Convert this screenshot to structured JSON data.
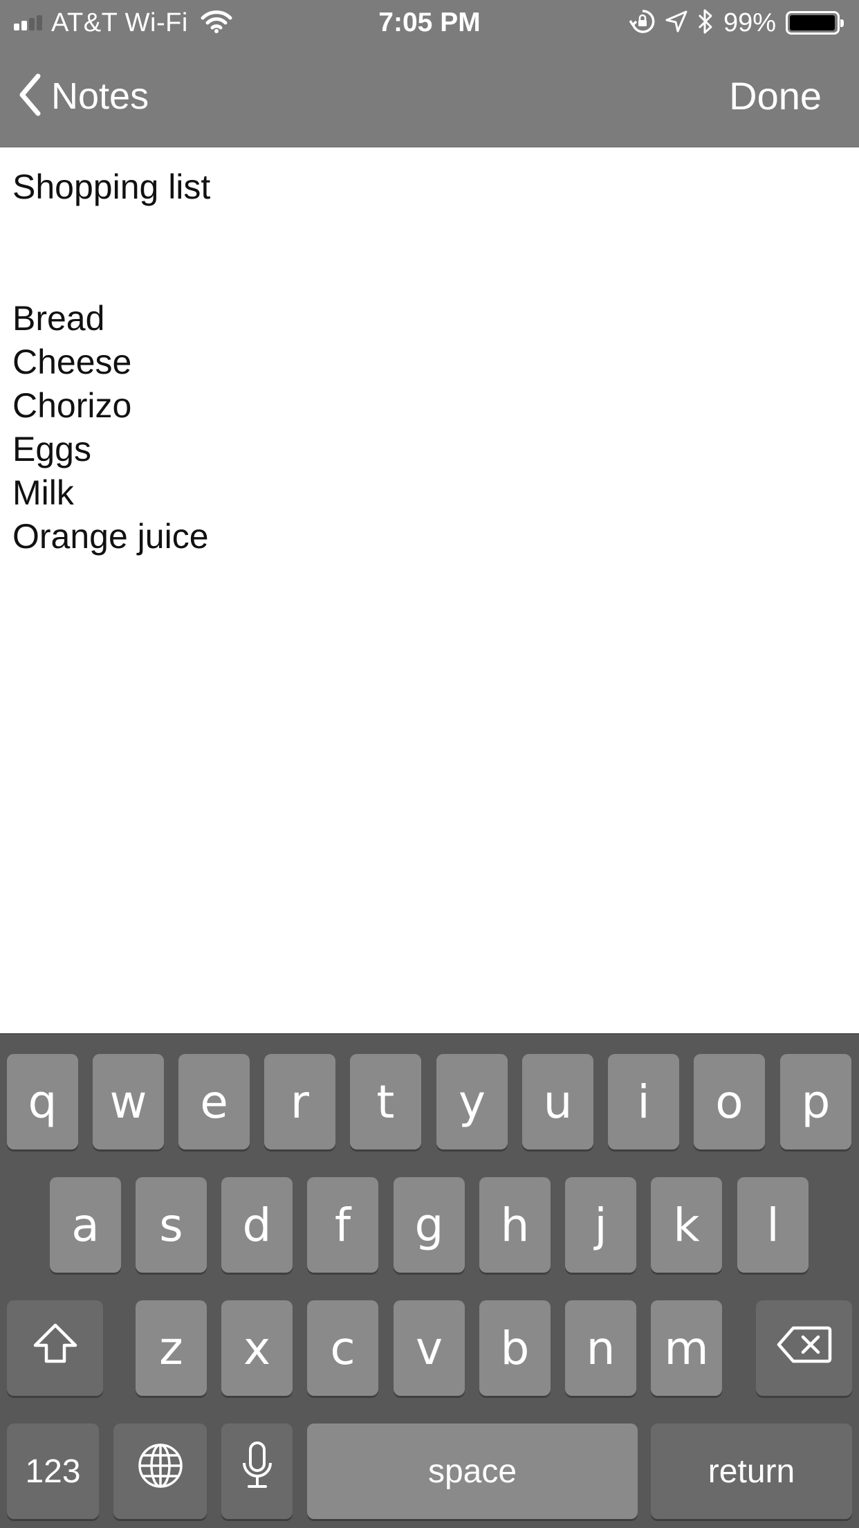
{
  "status_bar": {
    "carrier": "AT&T Wi-Fi",
    "time": "7:05 PM",
    "battery_percent": "99%",
    "battery_level": 0.99,
    "icons": [
      "signal-icon",
      "wifi-icon",
      "orientation-lock-icon",
      "location-arrow-icon",
      "bluetooth-icon",
      "battery-icon"
    ]
  },
  "nav": {
    "back_label": "Notes",
    "done_label": "Done"
  },
  "note": {
    "title": "Shopping list",
    "items": [
      "Bread",
      "Cheese",
      "Chorizo",
      "Eggs",
      "Milk",
      "Orange juice"
    ]
  },
  "keyboard": {
    "row1": [
      "q",
      "w",
      "e",
      "r",
      "t",
      "y",
      "u",
      "i",
      "o",
      "p"
    ],
    "row2": [
      "a",
      "s",
      "d",
      "f",
      "g",
      "h",
      "j",
      "k",
      "l"
    ],
    "row3": [
      "z",
      "x",
      "c",
      "v",
      "b",
      "n",
      "m"
    ],
    "numbers_label": "123",
    "space_label": "space",
    "return_label": "return",
    "icons": [
      "shift-icon",
      "backspace-icon",
      "globe-icon",
      "microphone-icon"
    ]
  },
  "colors": {
    "bar_background": "#7b7c7b",
    "keyboard_background": "#585858",
    "key_background": "#8a8a8a",
    "function_key_background": "#6a6a6a"
  }
}
